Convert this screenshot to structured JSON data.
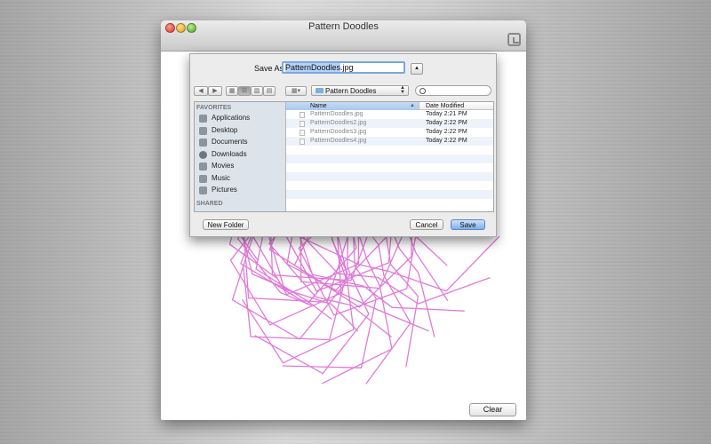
{
  "window": {
    "title": "Pattern Doodles"
  },
  "canvas": {
    "drawing_color": "#e07ad6",
    "clear_label": "Clear"
  },
  "save_sheet": {
    "save_as_label": "Save As:",
    "filename_base": "PatternDoodles",
    "filename_ext": ".jpg",
    "expand_icon": "triangle-up-icon",
    "location": "Pattern Doodles",
    "search_placeholder": "",
    "sidebar": {
      "favorites_heading": "FAVORITES",
      "shared_heading": "SHARED",
      "items": [
        {
          "label": "Applications",
          "icon": "applications-icon"
        },
        {
          "label": "Desktop",
          "icon": "desktop-icon"
        },
        {
          "label": "Documents",
          "icon": "documents-icon"
        },
        {
          "label": "Downloads",
          "icon": "downloads-icon"
        },
        {
          "label": "Movies",
          "icon": "movies-icon"
        },
        {
          "label": "Music",
          "icon": "music-icon"
        },
        {
          "label": "Pictures",
          "icon": "pictures-icon"
        }
      ]
    },
    "columns": {
      "name": "Name",
      "date": "Date Modified"
    },
    "files": [
      {
        "name": "PatternDoodles.jpg",
        "date": "Today 2:21 PM"
      },
      {
        "name": "PatternDoodles2.jpg",
        "date": "Today 2:22 PM"
      },
      {
        "name": "PatternDoodles3.jpg",
        "date": "Today 2:22 PM"
      },
      {
        "name": "PatternDoodles4.jpg",
        "date": "Today 2:22 PM"
      }
    ],
    "new_folder_label": "New Folder",
    "cancel_label": "Cancel",
    "save_label": "Save"
  }
}
